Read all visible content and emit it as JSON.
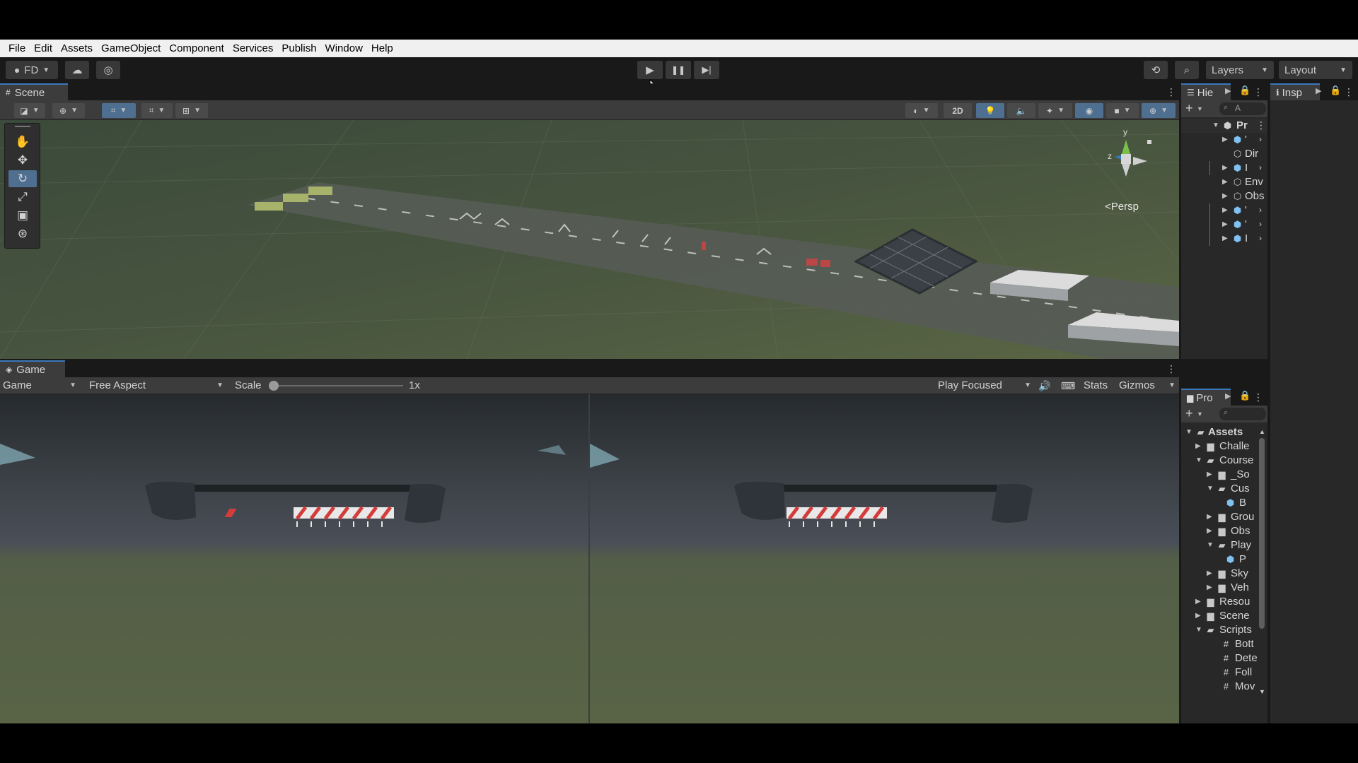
{
  "menu": [
    "File",
    "Edit",
    "Assets",
    "GameObject",
    "Component",
    "Services",
    "Publish",
    "Window",
    "Help"
  ],
  "toolbar": {
    "account": "FD",
    "layers": "Layers",
    "layout": "Layout"
  },
  "scene": {
    "tab": "Scene",
    "toggle_2d": "2D",
    "persp": "<Persp",
    "gizmo_axes": {
      "y": "y",
      "z": "z"
    }
  },
  "game": {
    "tab": "Game",
    "display": "Game",
    "aspect": "Free Aspect",
    "scale_label": "Scale",
    "scale_value": "1x",
    "play_mode": "Play Focused",
    "stats": "Stats",
    "gizmos": "Gizmos"
  },
  "hierarchy": {
    "tab": "Hie",
    "search": "A",
    "root": "Pr",
    "items": [
      "'",
      "Dir",
      "I",
      "Env",
      "Obs",
      "'",
      "'",
      "I"
    ]
  },
  "inspector": {
    "tab": "Insp"
  },
  "project": {
    "tab": "Pro",
    "items": [
      "Assets",
      "Challe",
      "Course",
      "_So",
      "Cus",
      "B",
      "Grou",
      "Obs",
      "Play",
      "P",
      "Sky",
      "Veh",
      "Resou",
      "Scene",
      "Scripts",
      "Bott",
      "Dete",
      "Foll",
      "Mov"
    ]
  },
  "colors": {
    "accent": "#3a79bb",
    "selected": "#4f6f91",
    "panel": "#282828",
    "toolbar": "#3c3c3c"
  }
}
